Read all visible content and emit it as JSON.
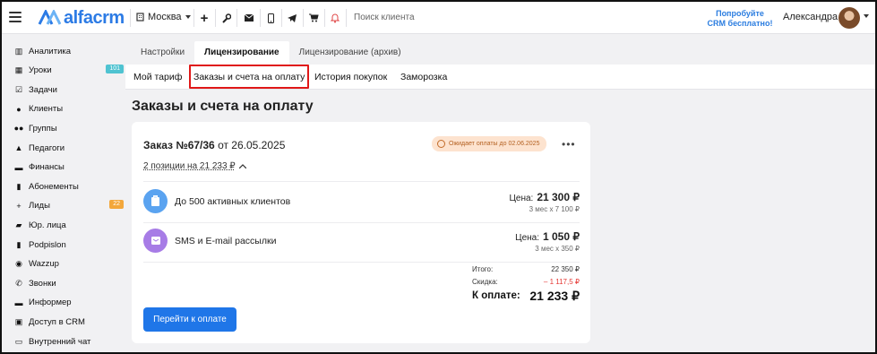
{
  "header": {
    "logo_text": "alfacrm",
    "branch": "Москва",
    "search_placeholder": "Поиск клиента",
    "trial_line1": "Попробуйте",
    "trial_line2": "CRM бесплатно!",
    "user_name": "Александра",
    "icons": [
      "plus-icon",
      "wrench-icon",
      "mail-icon",
      "phone-icon",
      "telegram-icon",
      "cart-icon",
      "bell-icon"
    ]
  },
  "sidebar": {
    "items": [
      {
        "label": "Аналитика",
        "icon": "chart-icon"
      },
      {
        "label": "Уроки",
        "icon": "calendar-icon",
        "badge": "101",
        "badge_color": "#4fc3d1"
      },
      {
        "label": "Задачи",
        "icon": "checklist-icon"
      },
      {
        "label": "Клиенты",
        "icon": "person-icon"
      },
      {
        "label": "Группы",
        "icon": "group-icon"
      },
      {
        "label": "Педагоги",
        "icon": "graduation-icon"
      },
      {
        "label": "Финансы",
        "icon": "money-icon"
      },
      {
        "label": "Абонементы",
        "icon": "ticket-icon"
      },
      {
        "label": "Лиды",
        "icon": "person-plus-icon",
        "badge": "22",
        "badge_color": "#f3a73b"
      },
      {
        "label": "Юр. лица",
        "icon": "briefcase-icon"
      },
      {
        "label": "Podpislon",
        "icon": "document-icon"
      },
      {
        "label": "Wazzup",
        "icon": "whatsapp-icon"
      },
      {
        "label": "Звонки",
        "icon": "phone-call-icon"
      },
      {
        "label": "Информер",
        "icon": "informer-icon"
      },
      {
        "label": "Доступ в CRM",
        "icon": "lock-icon"
      },
      {
        "label": "Внутренний чат",
        "icon": "chat-icon"
      }
    ]
  },
  "tabs": [
    "Настройки",
    "Лицензирование",
    "Лицензирование (архив)"
  ],
  "active_tab": 1,
  "subtabs": [
    "Мой тариф",
    "Заказы и счета на оплату",
    "История покупок",
    "Заморозка"
  ],
  "page_title": "Заказы и счета на оплату",
  "order": {
    "title_bold": "Заказ №67/36",
    "title_rest": " от 26.05.2025",
    "status": "Ожидает оплаты до 02.06.2025",
    "positions": "2 позиции на 21 233 ₽",
    "items": [
      {
        "name": "До 500 активных клиентов",
        "price_label": "Цена:",
        "price": "21 300 ₽",
        "detail": "3 мес х 7 100 ₽",
        "icon": "clipboard-icon",
        "color": "#5aa3f0"
      },
      {
        "name": "SMS и E-mail рассылки",
        "price_label": "Цена:",
        "price": "1 050 ₽",
        "detail": "3 мес х 350 ₽",
        "icon": "message-icon",
        "color": "#a77ce6"
      }
    ],
    "total_label": "Итого:",
    "total_value": "22 350 ₽",
    "discount_label": "Скидка:",
    "discount_value": "– 1 117,5 ₽",
    "pay_label": "К оплате:",
    "pay_value": "21 233 ₽",
    "pay_button": "Перейти к оплате"
  }
}
